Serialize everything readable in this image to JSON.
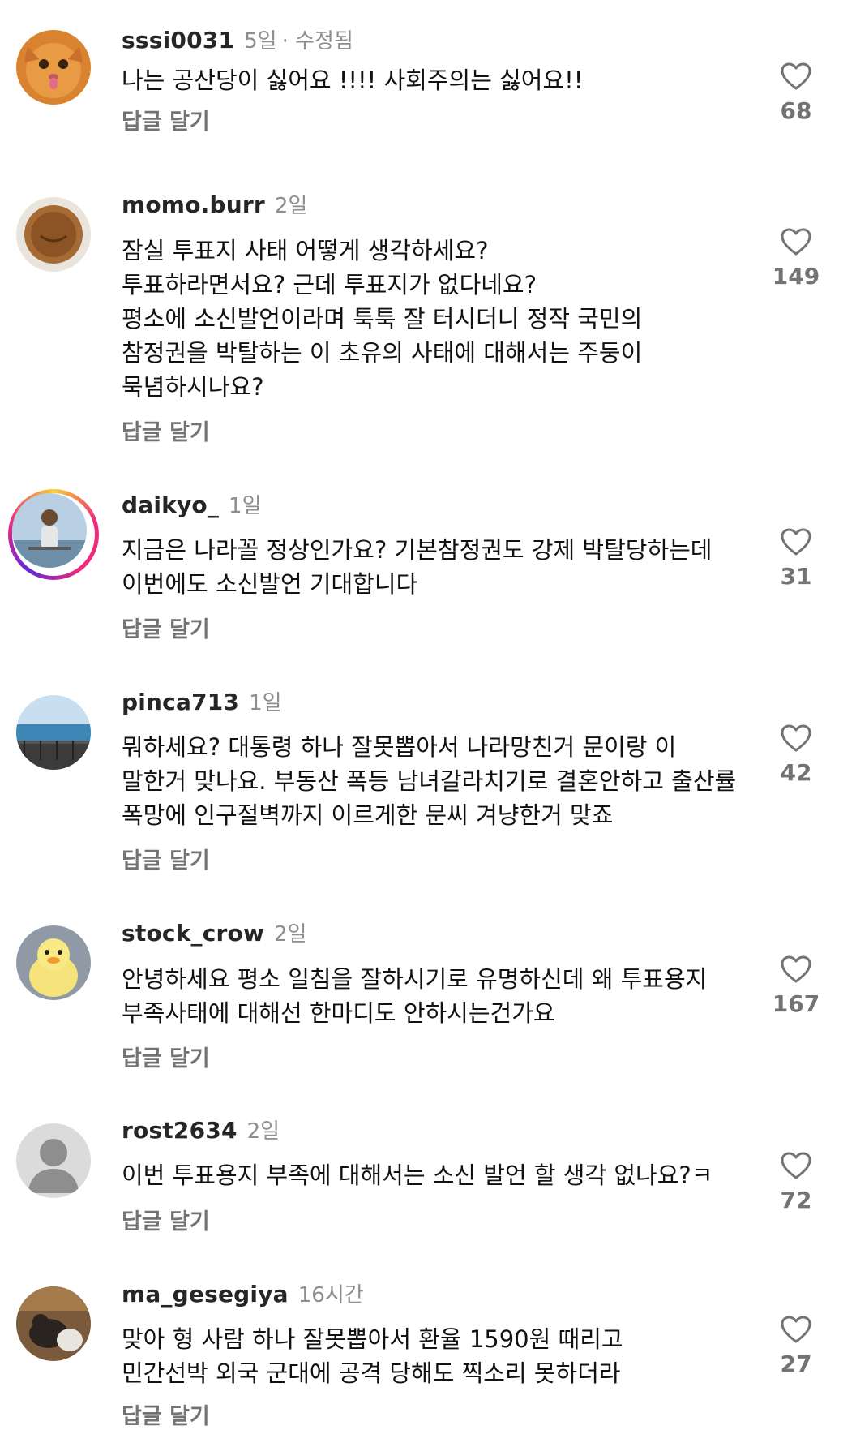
{
  "comments": [
    {
      "username": "sssi0031",
      "time": "5일",
      "edited": "· 수정됨",
      "lines": [
        "나는 공산당이 싫어요 !!!! 사회주의는  싫어요!!"
      ],
      "reply_label": "답글 달기",
      "likes": "68",
      "avatar_icon": "orange-cat-avatar"
    },
    {
      "username": "momo.burr",
      "time": "2일",
      "lines": [
        "잠실 투표지 사태 어떻게 생각하세요?",
        "투표하라면서요? 근데 투표지가 없다네요?",
        "평소에 소신발언이라며 툭툭 잘 터시더니 정작 국민의",
        "참정권을 박탈하는 이 초유의 사태에 대해서는 주둥이",
        "묵념하시나요?"
      ],
      "reply_label": "답글 달기",
      "likes": "149",
      "avatar_icon": "brown-bowl-avatar"
    },
    {
      "username": "daikyo_",
      "time": "1일",
      "lines": [
        "지금은 나라꼴 정상인가요? 기본참정권도 강제 박탈당하는데",
        "이번에도 소신발언 기대합니다"
      ],
      "reply_label": "답글 달기",
      "likes": "31",
      "avatar_icon": "person-photo-avatar"
    },
    {
      "username": "pinca713",
      "time": "1일",
      "lines": [
        "뭐하세요? 대통령 하나 잘못뽑아서 나라망친거 문이랑 이",
        "말한거 맞나요. 부동산 폭등 남녀갈라치기로 결혼안하고 출산률",
        "폭망에 인구절벽까지 이르게한 문씨 겨냥한거 맞죠"
      ],
      "reply_label": "답글 달기",
      "likes": "42",
      "avatar_icon": "sea-view-avatar"
    },
    {
      "username": "stock_crow",
      "time": "2일",
      "lines": [
        "안녕하세요 평소 일침을 잘하시기로 유명하신데 왜 투표용지",
        "부족사태에 대해선 한마디도 안하시는건가요"
      ],
      "reply_label": "답글 달기",
      "likes": "167",
      "avatar_icon": "duckling-avatar"
    },
    {
      "username": "rost2634",
      "time": "2일",
      "lines": [
        "이번 투표용지 부족에 대해서는 소신 발언 할 생각 없나요?ㅋ"
      ],
      "reply_label": "답글 달기",
      "likes": "72",
      "avatar_icon": "default-user-avatar"
    },
    {
      "username": "ma_gesegiya",
      "time": "16시간",
      "lines": [
        "맞아 형 사람 하나 잘못뽑아서 환율 1590원 때리고",
        "민간선박 외국 군대에 공격 당해도 찍소리 못하더라"
      ],
      "reply_label": "답글 달기",
      "likes": "27",
      "avatar_icon": "dog-photo-avatar"
    }
  ]
}
